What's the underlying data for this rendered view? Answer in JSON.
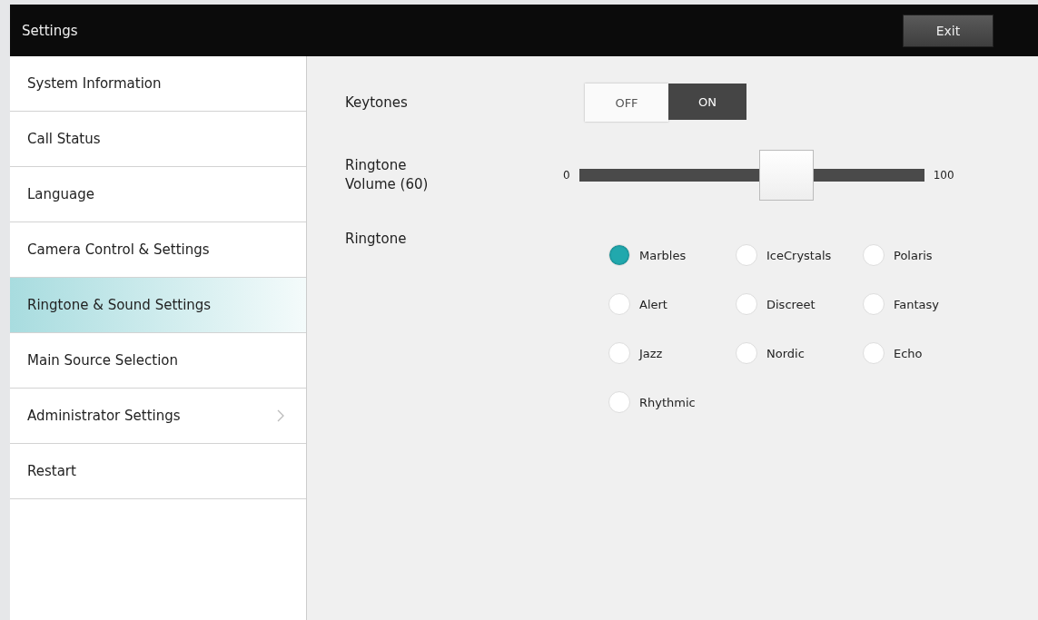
{
  "header": {
    "title": "Settings",
    "exit_button": "Exit"
  },
  "sidebar": {
    "items": [
      {
        "label": "System Information",
        "selected": false,
        "chevron": false
      },
      {
        "label": "Call Status",
        "selected": false,
        "chevron": false
      },
      {
        "label": "Language",
        "selected": false,
        "chevron": false
      },
      {
        "label": "Camera Control & Settings",
        "selected": false,
        "chevron": false
      },
      {
        "label": "Ringtone & Sound Settings",
        "selected": true,
        "chevron": false
      },
      {
        "label": "Main Source Selection",
        "selected": false,
        "chevron": false
      },
      {
        "label": "Administrator Settings",
        "selected": false,
        "chevron": true
      },
      {
        "label": "Restart",
        "selected": false,
        "chevron": false
      }
    ]
  },
  "keytones": {
    "label": "Keytones",
    "options": [
      {
        "label": "OFF",
        "selected": false
      },
      {
        "label": "ON",
        "selected": true
      }
    ]
  },
  "volume": {
    "label": "Ringtone Volume (60)",
    "min": "0",
    "max": "100",
    "level": 0.6
  },
  "ringtone": {
    "label": "Ringtone",
    "options": [
      {
        "label": "Marbles",
        "selected": true
      },
      {
        "label": "IceCrystals",
        "selected": false
      },
      {
        "label": "Polaris",
        "selected": false
      },
      {
        "label": "Alert",
        "selected": false
      },
      {
        "label": "Discreet",
        "selected": false
      },
      {
        "label": "Fantasy",
        "selected": false
      },
      {
        "label": "Jazz",
        "selected": false
      },
      {
        "label": "Nordic",
        "selected": false
      },
      {
        "label": "Echo",
        "selected": false
      },
      {
        "label": "Rhythmic",
        "selected": false
      }
    ]
  }
}
